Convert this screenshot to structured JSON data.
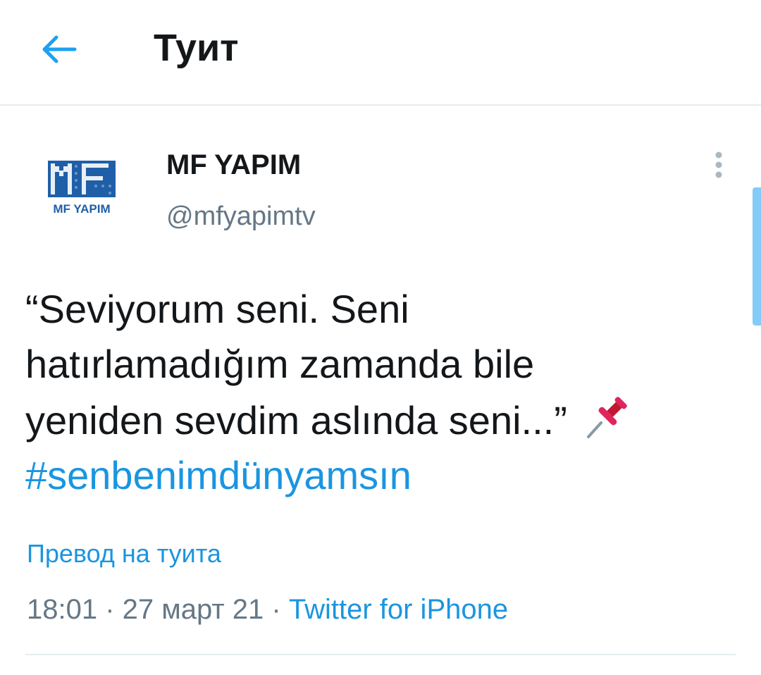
{
  "header": {
    "title": "Туит",
    "back_icon": "arrow-left-icon",
    "accent_color": "#1da1f2"
  },
  "tweet": {
    "author": {
      "display_name": "MF YAPIM",
      "handle": "@mfyapimtv",
      "avatar_logo_text": "MF YAPIM"
    },
    "text_lines": [
      "“Seviyorum seni. Seni",
      "hatırlamadığım zamanda bile",
      "yeniden sevdim aslında seni...”"
    ],
    "emoji_icon": "pushpin-icon",
    "hashtag": "#senbenimdünyamsın",
    "translate_label": "Превод на туита",
    "time": "18:01",
    "separator": " · ",
    "date": "27 март 21",
    "source": "Twitter for iPhone",
    "more_icon": "more-vertical-icon"
  }
}
